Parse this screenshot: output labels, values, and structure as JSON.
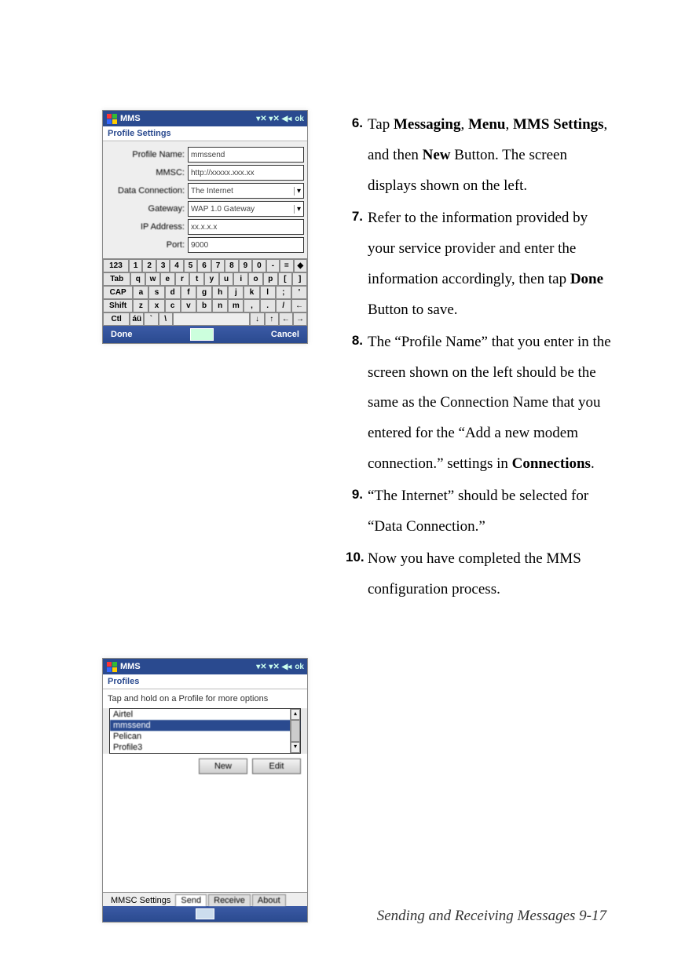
{
  "footer": "Sending and Receiving Messages    9-17",
  "steps": {
    "s6": {
      "num": "6.",
      "p1": "Tap ",
      "b1": "Messaging",
      "sep1": ", ",
      "b2": "Menu",
      "sep2": ", ",
      "b3": "MMS Settings",
      "sep3": ", and then ",
      "b4": "New",
      "p2": " Button. The screen displays shown on the left."
    },
    "s7": {
      "num": "7.",
      "p1": "Refer to the information provided by your service provider and enter the information accordingly, then tap ",
      "b1": "Done",
      "p2": " Button to save."
    },
    "s8": {
      "num": "8.",
      "p1": "The “Profile Name” that you enter in the screen shown on the left should be the same as the Connection Name that you entered for the “Add a new modem connection.” settings in ",
      "b1": "Connections",
      "p2": "."
    },
    "s9": {
      "num": "9.",
      "p1": "“The Internet” should be selected for “Data Connection.”"
    },
    "s10": {
      "num": "10.",
      "p1": " Now you have completed the MMS configuration process."
    }
  },
  "screen1": {
    "title": "MMS",
    "ok": "ok",
    "subtitle": "Profile Settings",
    "labels": {
      "profileName": "Profile Name:",
      "mmsc": "MMSC:",
      "dataConn": "Data Connection:",
      "gateway": "Gateway:",
      "ip": "IP Address:",
      "port": "Port:"
    },
    "values": {
      "profileName": "mmssend",
      "mmsc": "http://xxxxx.xxx.xx",
      "dataConn": "The Internet",
      "gateway": "WAP 1.0 Gateway",
      "ip": "xx.x.x.x",
      "port": "9000"
    },
    "keyboard": {
      "r1": [
        "123",
        "1",
        "2",
        "3",
        "4",
        "5",
        "6",
        "7",
        "8",
        "9",
        "0",
        "-",
        "=",
        "◆"
      ],
      "r2": [
        "Tab",
        "q",
        "w",
        "e",
        "r",
        "t",
        "y",
        "u",
        "i",
        "o",
        "p",
        "[",
        "]"
      ],
      "r3": [
        "CAP",
        "a",
        "s",
        "d",
        "f",
        "g",
        "h",
        "j",
        "k",
        "l",
        ";",
        "'"
      ],
      "r4": [
        "Shift",
        "z",
        "x",
        "c",
        "v",
        "b",
        "n",
        "m",
        ",",
        ".",
        "/",
        "←"
      ],
      "r5": [
        "Ctl",
        "áü",
        "`",
        "\\",
        "",
        "↓",
        "↑",
        "←",
        "→"
      ]
    },
    "bottom": {
      "left": "Done",
      "right": "Cancel"
    }
  },
  "screen2": {
    "title": "MMS",
    "ok": "ok",
    "subtitle": "Profiles",
    "hint": "Tap and hold on a Profile for more options",
    "items": [
      "Airtel",
      "mmssend",
      "Pelican",
      "Profile3"
    ],
    "buttons": {
      "new": "New",
      "edit": "Edit"
    },
    "tabs": {
      "label": "MMSC Settings",
      "t1": "Send",
      "t2": "Receive",
      "t3": "About"
    }
  }
}
